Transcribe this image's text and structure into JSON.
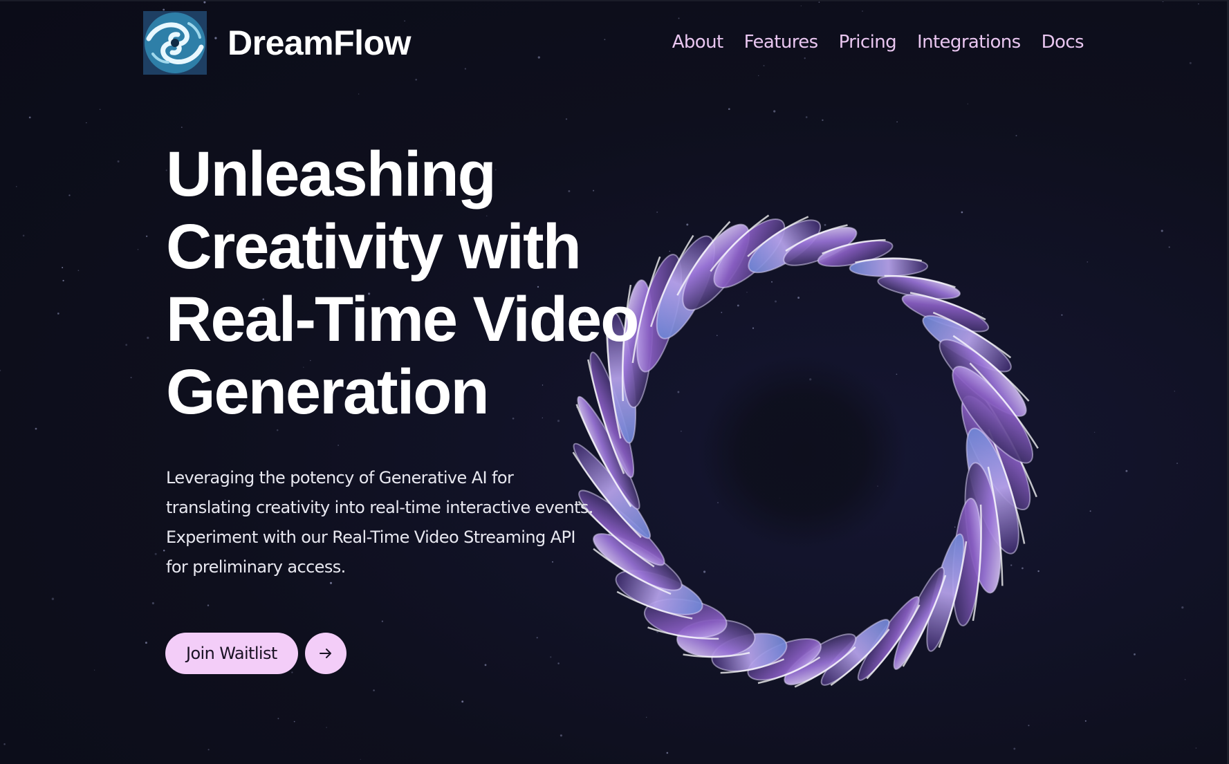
{
  "brand": {
    "name": "DreamFlow",
    "logo_icon": "swirl-wave-logo-icon"
  },
  "nav": {
    "items": [
      {
        "label": "About"
      },
      {
        "label": "Features"
      },
      {
        "label": "Pricing"
      },
      {
        "label": "Integrations"
      },
      {
        "label": "Docs"
      }
    ]
  },
  "hero": {
    "headline_lines": [
      "Unleashing",
      "Creativity with",
      "Real-Time Video",
      "Generation"
    ],
    "subcopy_lines": [
      "Leveraging the potency of Generative AI for",
      "translating creativity into real-time interactive events.",
      "Experiment with our Real-Time Video Streaming API",
      "for preliminary access."
    ],
    "cta_label": "Join Waitlist",
    "cta_icon": "arrow-right-icon"
  },
  "colors": {
    "background": "#0e0f1d",
    "nav_text": "#e9c6f0",
    "button_bg": "#f3cdf8",
    "button_text": "#1a1224",
    "art_purple": "#8a5fc4",
    "art_lavender": "#b9a5ee",
    "art_blue": "#6f86d6"
  }
}
